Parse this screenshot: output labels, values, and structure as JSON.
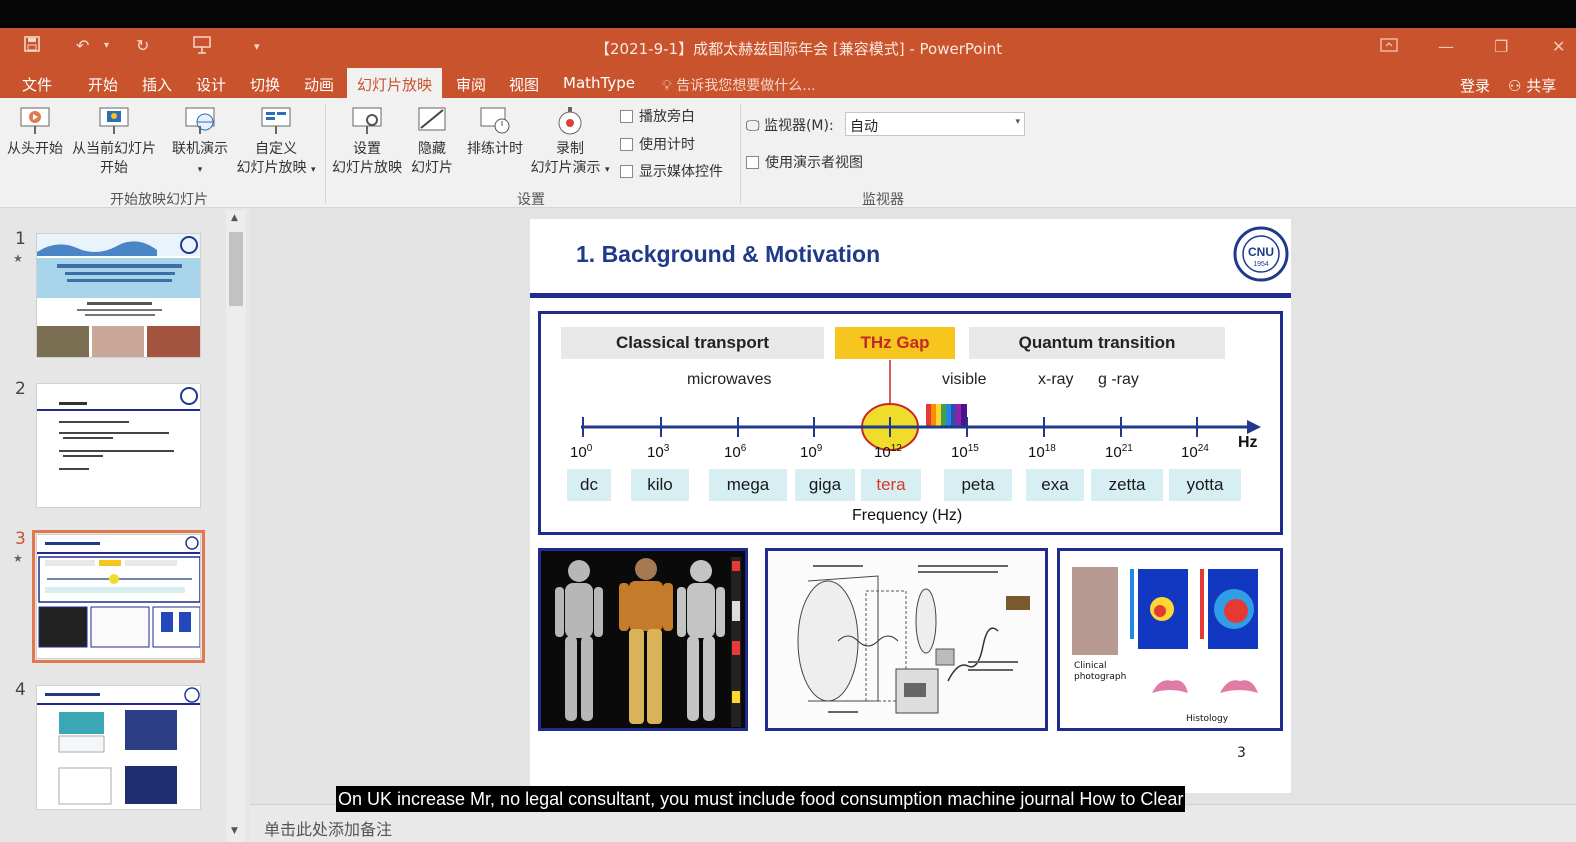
{
  "window": {
    "title": "【2021-9-1】成都太赫兹国际年会 [兼容模式] - PowerPoint"
  },
  "tabs": [
    {
      "label": "文件"
    },
    {
      "label": "开始"
    },
    {
      "label": "插入"
    },
    {
      "label": "设计"
    },
    {
      "label": "切换"
    },
    {
      "label": "动画"
    },
    {
      "label": "幻灯片放映"
    },
    {
      "label": "审阅"
    },
    {
      "label": "视图"
    },
    {
      "label": "MathType"
    }
  ],
  "active_tab": "幻灯片放映",
  "tellme": "告诉我您想要做什么...",
  "account": {
    "login": "登录",
    "share": "共享"
  },
  "ribbon": {
    "start_group": {
      "label": "开始放映幻灯片",
      "from_beginning": "从头开始",
      "from_current_1": "从当前幻灯片",
      "from_current_2": "开始",
      "online_present": "联机演示",
      "custom_1": "自定义",
      "custom_2": "幻灯片放映"
    },
    "setup_group": {
      "label": "设置",
      "setup_1": "设置",
      "setup_2": "幻灯片放映",
      "hide_1": "隐藏",
      "hide_2": "幻灯片",
      "rehearse": "排练计时",
      "record_1": "录制",
      "record_2": "幻灯片演示",
      "play_narration": "播放旁白",
      "use_timings": "使用计时",
      "show_media": "显示媒体控件"
    },
    "monitor_group": {
      "label": "监视器",
      "monitor_label": "监视器(M):",
      "monitor_value": "自动",
      "presenter_view": "使用演示者视图"
    }
  },
  "thumbnails": [
    {
      "num": "1",
      "starred": true,
      "selected": false
    },
    {
      "num": "2",
      "starred": false,
      "selected": false
    },
    {
      "num": "3",
      "starred": true,
      "selected": true
    },
    {
      "num": "4",
      "starred": false,
      "selected": false
    }
  ],
  "slide": {
    "title": "1.  Background & Motivation",
    "page": "3",
    "logo_text": "CNU 1954",
    "headers": {
      "classical": "Classical transport",
      "gap": "THz Gap",
      "quantum": "Quantum transition"
    },
    "bands": {
      "microwaves": "microwaves",
      "visible": "visible",
      "xray": "x-ray",
      "gray": "g -ray"
    },
    "ticks": [
      {
        "base": "10",
        "exp": "0"
      },
      {
        "base": "10",
        "exp": "3"
      },
      {
        "base": "10",
        "exp": "6"
      },
      {
        "base": "10",
        "exp": "9"
      },
      {
        "base": "10",
        "exp": "12"
      },
      {
        "base": "10",
        "exp": "15"
      },
      {
        "base": "10",
        "exp": "18"
      },
      {
        "base": "10",
        "exp": "21"
      },
      {
        "base": "10",
        "exp": "24"
      }
    ],
    "prefixes": [
      "dc",
      "kilo",
      "mega",
      "giga",
      "tera",
      "peta",
      "exa",
      "zetta",
      "yotta"
    ],
    "axis_unit": "Hz",
    "axis_label": "Frequency (Hz)",
    "img3_labels": {
      "clinical": "Clinical photograph",
      "histology": "Histology"
    }
  },
  "notes_placeholder": "单击此处添加备注",
  "caption": "On UK increase Mr, no legal consultant, you must include food consumption machine journal How to Clear"
}
